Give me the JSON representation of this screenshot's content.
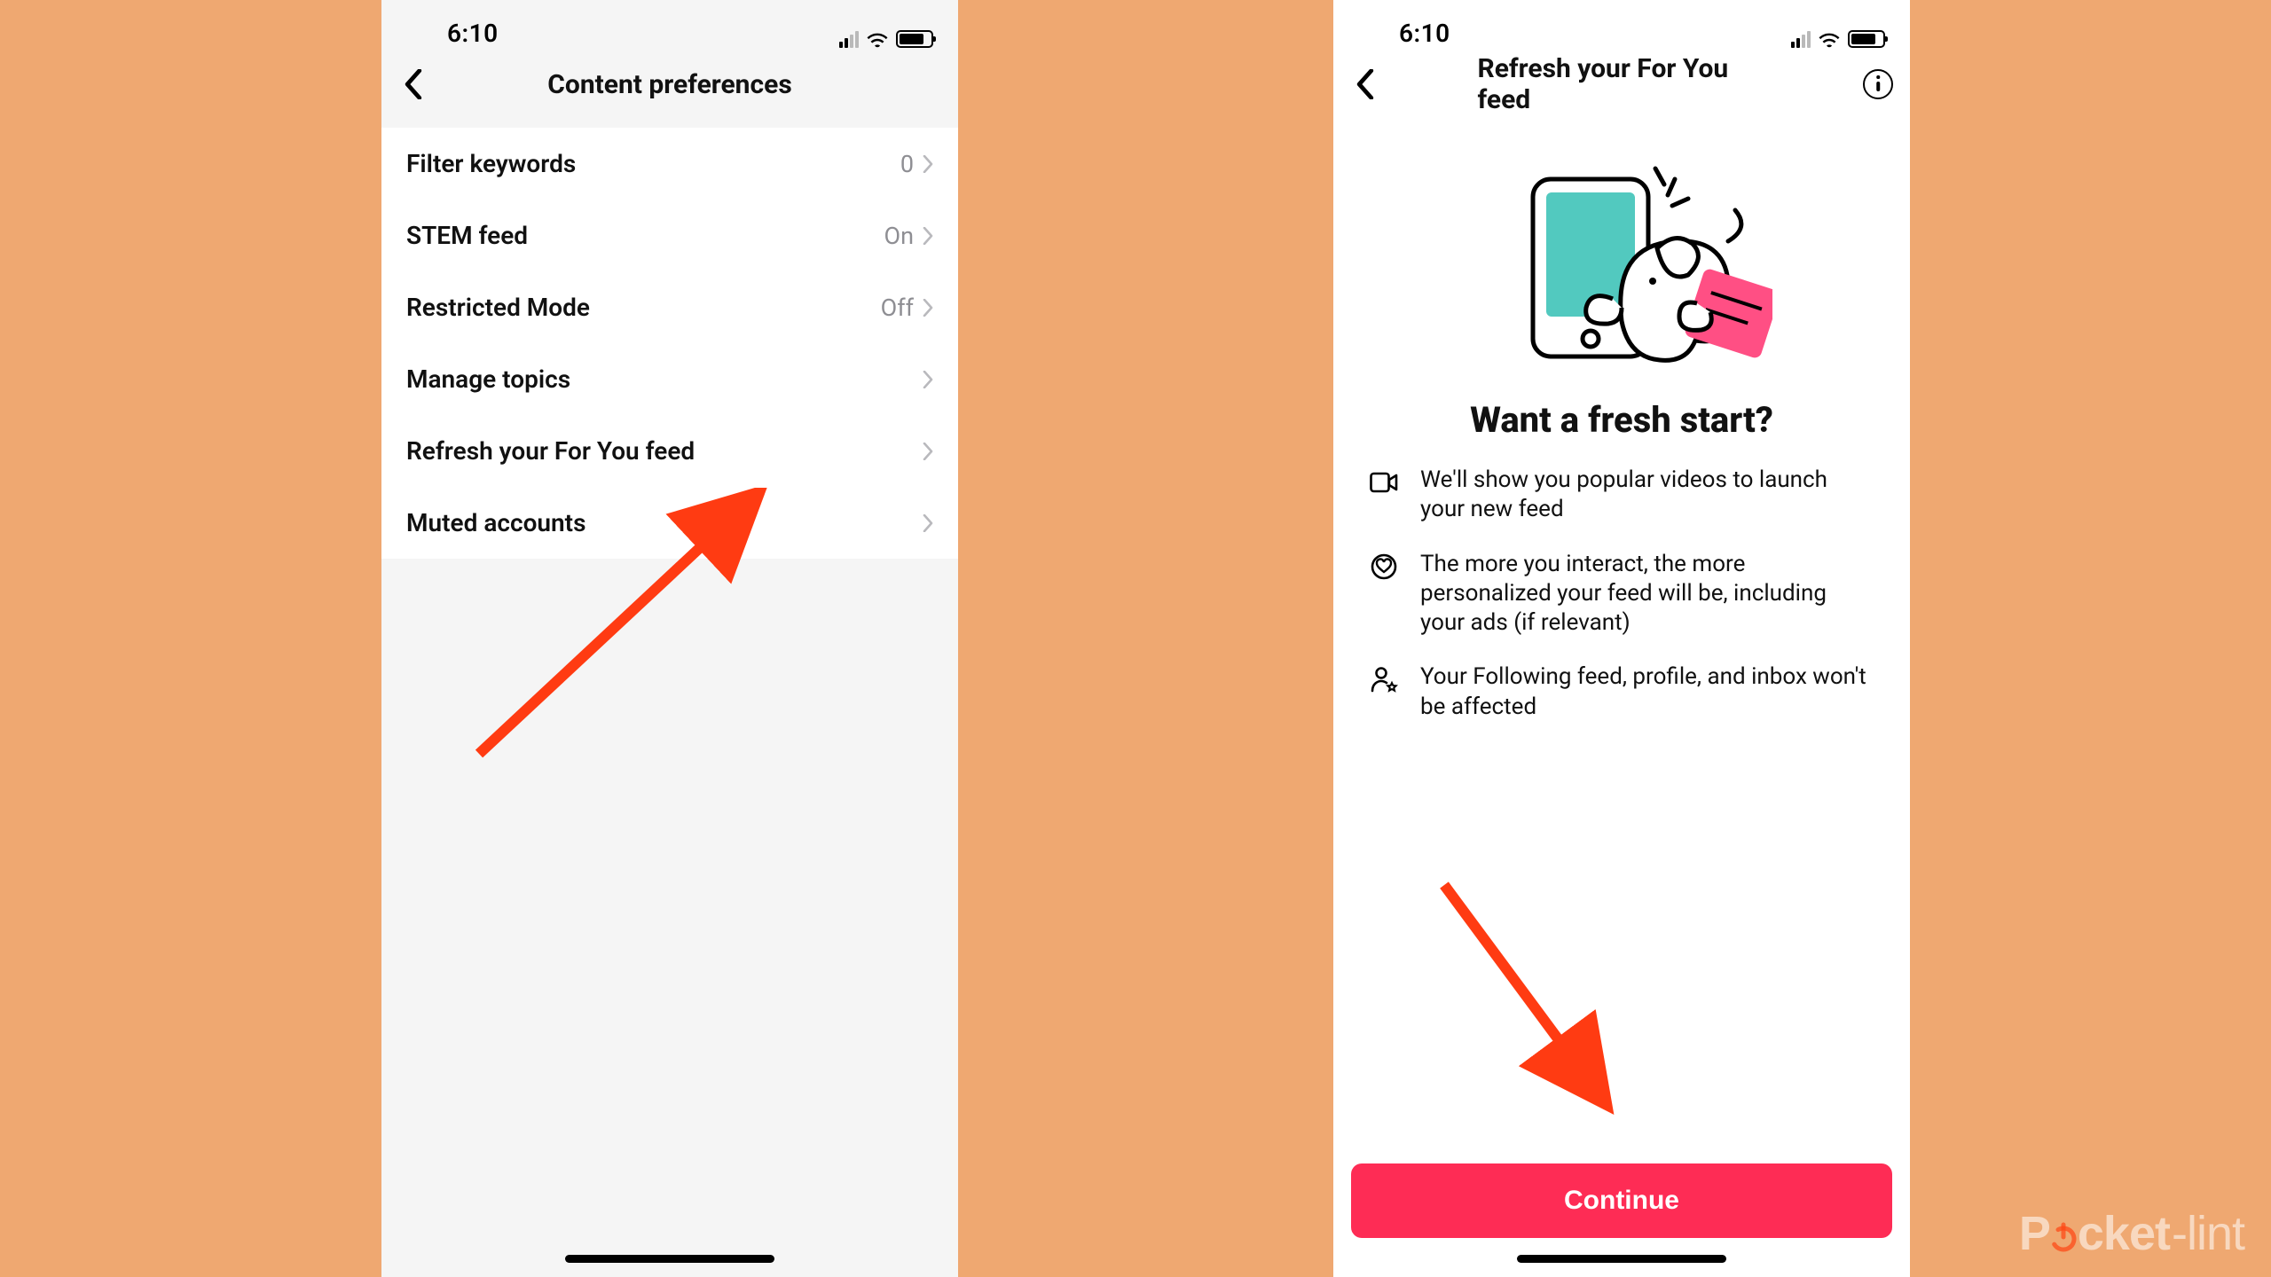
{
  "status": {
    "time": "6:10"
  },
  "screen1": {
    "title": "Content preferences",
    "rows": [
      {
        "label": "Filter keywords",
        "value": "0"
      },
      {
        "label": "STEM feed",
        "value": "On"
      },
      {
        "label": "Restricted Mode",
        "value": "Off"
      },
      {
        "label": "Manage topics",
        "value": ""
      },
      {
        "label": "Refresh your For You feed",
        "value": ""
      },
      {
        "label": "Muted accounts",
        "value": ""
      }
    ]
  },
  "screen2": {
    "title": "Refresh your For You feed",
    "heading": "Want a fresh start?",
    "bullets": [
      "We'll show you popular videos to launch your new feed",
      "The more you interact, the more personalized your feed will be, including your ads (if relevant)",
      "Your Following feed, profile, and inbox won't be affected"
    ],
    "cta": "Continue"
  },
  "watermark": {
    "pre": "P",
    "mid": "cket",
    "post": "lint"
  },
  "colors": {
    "accent": "#fe2c55",
    "bg": "#efa871",
    "arrow": "#ff3b12"
  }
}
